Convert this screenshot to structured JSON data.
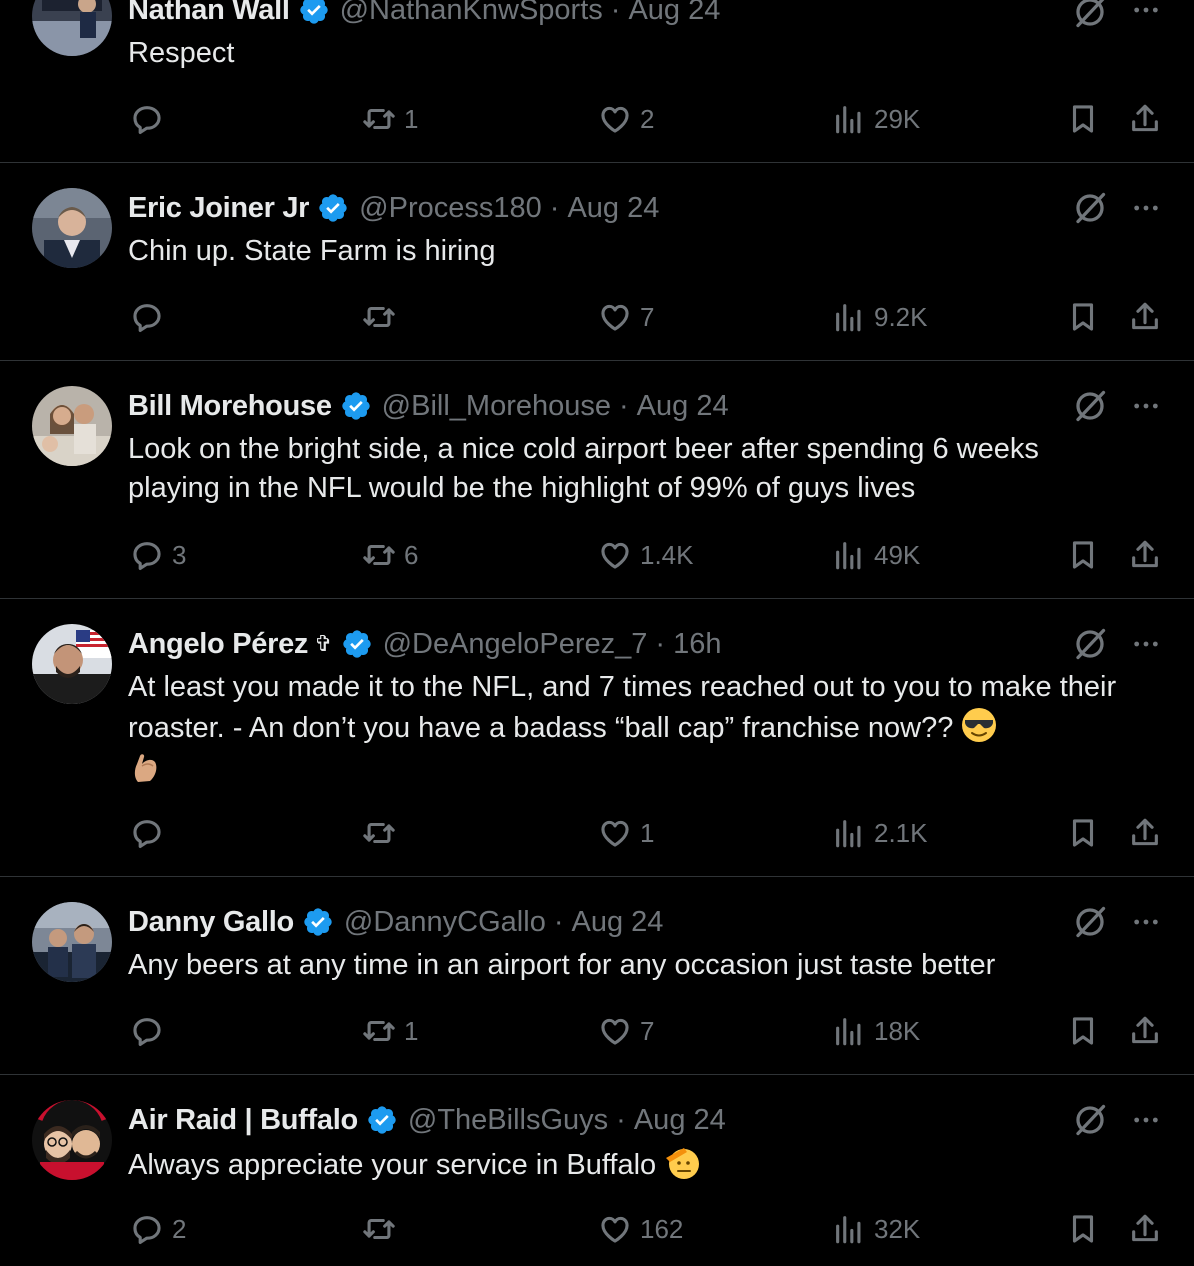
{
  "colors": {
    "background": "#000000",
    "text": "#e7e9ea",
    "muted": "#71767b",
    "divider": "#2f3336",
    "verified": "#1d9bf0"
  },
  "tweets": [
    {
      "name": "Nathan Wall",
      "handle": "@NathanKnwSports",
      "time": "Aug 24",
      "text": "Respect",
      "replies": "",
      "reposts": "1",
      "likes": "2",
      "views": "29K",
      "avatar_icon": "avatar-photo-icon"
    },
    {
      "name": "Eric Joiner Jr",
      "handle": "@Process180",
      "time": "Aug 24",
      "text": "Chin up.  State Farm is hiring",
      "replies": "",
      "reposts": "",
      "likes": "7",
      "views": "9.2K",
      "avatar_icon": "avatar-photo-icon"
    },
    {
      "name": "Bill Morehouse",
      "handle": "@Bill_Morehouse",
      "time": "Aug 24",
      "text": "Look on the bright side, a nice cold airport beer after spending 6 weeks playing in the NFL would be the highlight of 99% of guys lives",
      "replies": "3",
      "reposts": "6",
      "likes": "1.4K",
      "views": "49K",
      "avatar_icon": "avatar-photo-icon"
    },
    {
      "name": "Angelo Pérez",
      "name_suffix": "✞",
      "handle": "@DeAngeloPerez_7",
      "time": "16h",
      "text": "At least you made it to the NFL, and 7 times reached out to you to make their roaster.  - An don’t you have a badass “ball cap” franchise now??",
      "replies": "",
      "reposts": "",
      "likes": "1",
      "views": "2.1K",
      "avatar_icon": "avatar-photo-icon"
    },
    {
      "name": "Danny Gallo",
      "handle": "@DannyCGallo",
      "time": "Aug 24",
      "text": "Any beers at any time in an airport for any occasion just taste better",
      "replies": "",
      "reposts": "1",
      "likes": "7",
      "views": "18K",
      "avatar_icon": "avatar-photo-icon"
    },
    {
      "name": "Air Raid | Buffalo",
      "handle": "@TheBillsGuys",
      "time": "Aug 24",
      "text": "Always appreciate your service in Buffalo",
      "replies": "2",
      "reposts": "",
      "likes": "162",
      "views": "32K",
      "avatar_icon": "avatar-cartoon-icon"
    }
  ],
  "icons": {
    "reply": "reply-icon",
    "repost": "repost-icon",
    "like": "like-icon",
    "views": "views-icon",
    "bookmark": "bookmark-icon",
    "share": "share-icon",
    "grok": "grok-icon",
    "more": "more-icon",
    "verified": "verified-badge-icon"
  }
}
